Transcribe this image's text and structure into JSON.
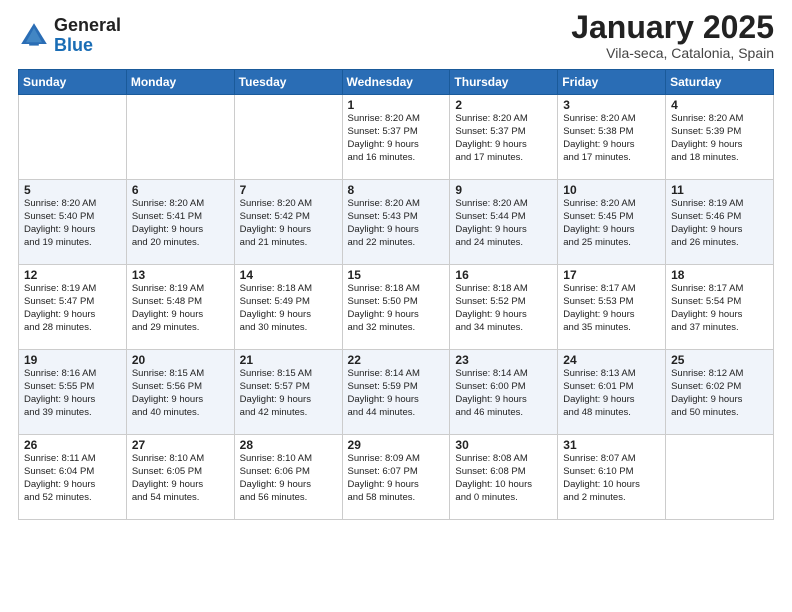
{
  "header": {
    "logo_general": "General",
    "logo_blue": "Blue",
    "month_title": "January 2025",
    "location": "Vila-seca, Catalonia, Spain"
  },
  "weekdays": [
    "Sunday",
    "Monday",
    "Tuesday",
    "Wednesday",
    "Thursday",
    "Friday",
    "Saturday"
  ],
  "weeks": [
    [
      {
        "day": "",
        "info": ""
      },
      {
        "day": "",
        "info": ""
      },
      {
        "day": "",
        "info": ""
      },
      {
        "day": "1",
        "info": "Sunrise: 8:20 AM\nSunset: 5:37 PM\nDaylight: 9 hours\nand 16 minutes."
      },
      {
        "day": "2",
        "info": "Sunrise: 8:20 AM\nSunset: 5:37 PM\nDaylight: 9 hours\nand 17 minutes."
      },
      {
        "day": "3",
        "info": "Sunrise: 8:20 AM\nSunset: 5:38 PM\nDaylight: 9 hours\nand 17 minutes."
      },
      {
        "day": "4",
        "info": "Sunrise: 8:20 AM\nSunset: 5:39 PM\nDaylight: 9 hours\nand 18 minutes."
      }
    ],
    [
      {
        "day": "5",
        "info": "Sunrise: 8:20 AM\nSunset: 5:40 PM\nDaylight: 9 hours\nand 19 minutes."
      },
      {
        "day": "6",
        "info": "Sunrise: 8:20 AM\nSunset: 5:41 PM\nDaylight: 9 hours\nand 20 minutes."
      },
      {
        "day": "7",
        "info": "Sunrise: 8:20 AM\nSunset: 5:42 PM\nDaylight: 9 hours\nand 21 minutes."
      },
      {
        "day": "8",
        "info": "Sunrise: 8:20 AM\nSunset: 5:43 PM\nDaylight: 9 hours\nand 22 minutes."
      },
      {
        "day": "9",
        "info": "Sunrise: 8:20 AM\nSunset: 5:44 PM\nDaylight: 9 hours\nand 24 minutes."
      },
      {
        "day": "10",
        "info": "Sunrise: 8:20 AM\nSunset: 5:45 PM\nDaylight: 9 hours\nand 25 minutes."
      },
      {
        "day": "11",
        "info": "Sunrise: 8:19 AM\nSunset: 5:46 PM\nDaylight: 9 hours\nand 26 minutes."
      }
    ],
    [
      {
        "day": "12",
        "info": "Sunrise: 8:19 AM\nSunset: 5:47 PM\nDaylight: 9 hours\nand 28 minutes."
      },
      {
        "day": "13",
        "info": "Sunrise: 8:19 AM\nSunset: 5:48 PM\nDaylight: 9 hours\nand 29 minutes."
      },
      {
        "day": "14",
        "info": "Sunrise: 8:18 AM\nSunset: 5:49 PM\nDaylight: 9 hours\nand 30 minutes."
      },
      {
        "day": "15",
        "info": "Sunrise: 8:18 AM\nSunset: 5:50 PM\nDaylight: 9 hours\nand 32 minutes."
      },
      {
        "day": "16",
        "info": "Sunrise: 8:18 AM\nSunset: 5:52 PM\nDaylight: 9 hours\nand 34 minutes."
      },
      {
        "day": "17",
        "info": "Sunrise: 8:17 AM\nSunset: 5:53 PM\nDaylight: 9 hours\nand 35 minutes."
      },
      {
        "day": "18",
        "info": "Sunrise: 8:17 AM\nSunset: 5:54 PM\nDaylight: 9 hours\nand 37 minutes."
      }
    ],
    [
      {
        "day": "19",
        "info": "Sunrise: 8:16 AM\nSunset: 5:55 PM\nDaylight: 9 hours\nand 39 minutes."
      },
      {
        "day": "20",
        "info": "Sunrise: 8:15 AM\nSunset: 5:56 PM\nDaylight: 9 hours\nand 40 minutes."
      },
      {
        "day": "21",
        "info": "Sunrise: 8:15 AM\nSunset: 5:57 PM\nDaylight: 9 hours\nand 42 minutes."
      },
      {
        "day": "22",
        "info": "Sunrise: 8:14 AM\nSunset: 5:59 PM\nDaylight: 9 hours\nand 44 minutes."
      },
      {
        "day": "23",
        "info": "Sunrise: 8:14 AM\nSunset: 6:00 PM\nDaylight: 9 hours\nand 46 minutes."
      },
      {
        "day": "24",
        "info": "Sunrise: 8:13 AM\nSunset: 6:01 PM\nDaylight: 9 hours\nand 48 minutes."
      },
      {
        "day": "25",
        "info": "Sunrise: 8:12 AM\nSunset: 6:02 PM\nDaylight: 9 hours\nand 50 minutes."
      }
    ],
    [
      {
        "day": "26",
        "info": "Sunrise: 8:11 AM\nSunset: 6:04 PM\nDaylight: 9 hours\nand 52 minutes."
      },
      {
        "day": "27",
        "info": "Sunrise: 8:10 AM\nSunset: 6:05 PM\nDaylight: 9 hours\nand 54 minutes."
      },
      {
        "day": "28",
        "info": "Sunrise: 8:10 AM\nSunset: 6:06 PM\nDaylight: 9 hours\nand 56 minutes."
      },
      {
        "day": "29",
        "info": "Sunrise: 8:09 AM\nSunset: 6:07 PM\nDaylight: 9 hours\nand 58 minutes."
      },
      {
        "day": "30",
        "info": "Sunrise: 8:08 AM\nSunset: 6:08 PM\nDaylight: 10 hours\nand 0 minutes."
      },
      {
        "day": "31",
        "info": "Sunrise: 8:07 AM\nSunset: 6:10 PM\nDaylight: 10 hours\nand 2 minutes."
      },
      {
        "day": "",
        "info": ""
      }
    ]
  ]
}
